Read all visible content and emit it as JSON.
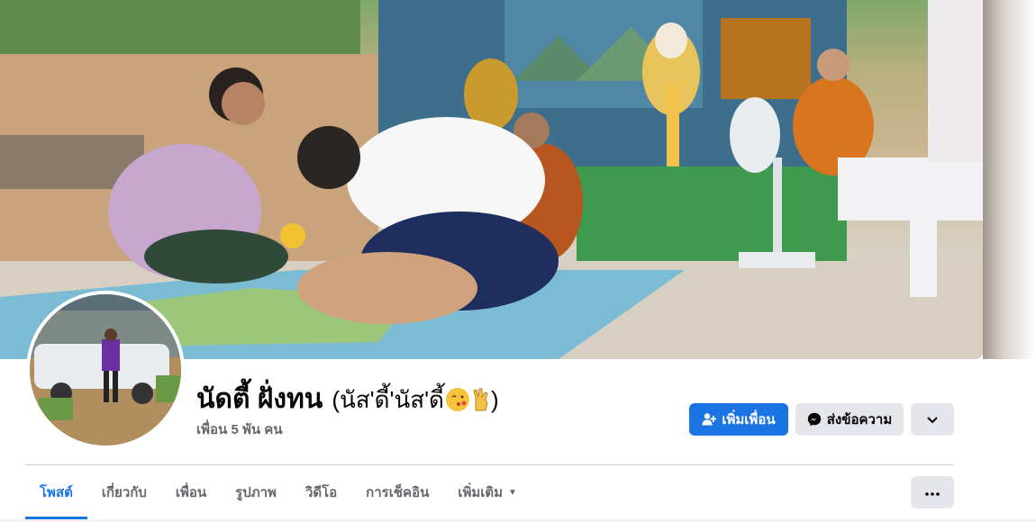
{
  "profile": {
    "name": "นัดตี้ ฝั่งทน",
    "alternate_name": "(นัส'ดี้'นัส'ดี้",
    "alternate_name_close": ")",
    "friends_count": "เพื่อน 5 พัน คน"
  },
  "actions": {
    "add_friend_label": "เพิ่มเพื่อน",
    "message_label": "ส่งข้อความ"
  },
  "tabs": [
    {
      "label": "โพสต์",
      "active": true
    },
    {
      "label": "เกี่ยวกับ"
    },
    {
      "label": "เพื่อน"
    },
    {
      "label": "รูปภาพ"
    },
    {
      "label": "วิดีโอ"
    },
    {
      "label": "การเช็คอิน"
    },
    {
      "label": "เพิ่มเติม"
    }
  ],
  "colors": {
    "accent": "#1b74e4",
    "secondary_button": "#e4e6eb",
    "muted_text": "#65676b"
  },
  "icons": {
    "add_friend": "person-plus-icon",
    "message": "messenger-icon",
    "more": "chevron-down-icon",
    "tab_more": "ellipsis-icon",
    "tab_caret": "caret-down-icon"
  }
}
